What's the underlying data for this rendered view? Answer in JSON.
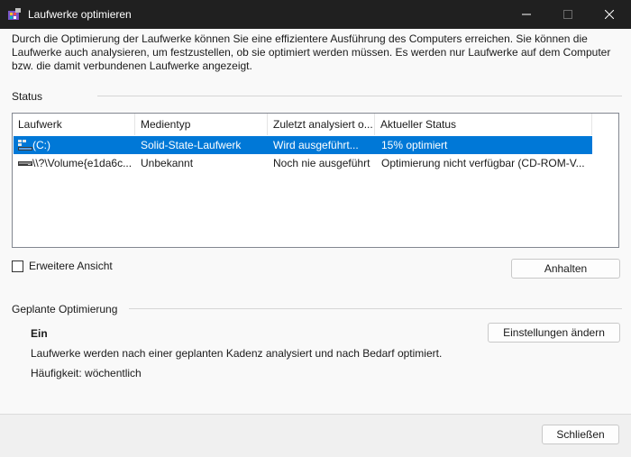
{
  "window": {
    "title": "Laufwerke optimieren"
  },
  "intro": {
    "text": "Durch die Optimierung der Laufwerke können Sie eine effizientere Ausführung des Computers erreichen. Sie können die Laufwerke auch analysieren, um festzustellen, ob sie optimiert werden müssen. Es werden nur Laufwerke auf dem Computer bzw. die damit verbundenen Laufwerke angezeigt."
  },
  "status": {
    "label": "Status",
    "columns": [
      "Laufwerk",
      "Medientyp",
      "Zuletzt analysiert o...",
      "Aktueller Status"
    ],
    "rows": [
      {
        "icon": "ssd-drive-icon",
        "drive": "(C:)",
        "media_type": "Solid-State-Laufwerk",
        "last_analyzed": "Wird ausgeführt...",
        "current_status": "15% optimiert",
        "selected": true
      },
      {
        "icon": "cdrom-drive-icon",
        "drive": "\\\\?\\Volume{e1da6c...",
        "media_type": "Unbekannt",
        "last_analyzed": "Noch nie ausgeführt",
        "current_status": "Optimierung nicht verfügbar (CD-ROM-V...",
        "selected": false
      }
    ],
    "advanced_view_label": "Erweitere Ansicht",
    "advanced_view_checked": false,
    "stop_button": "Anhalten"
  },
  "scheduled": {
    "label": "Geplante Optimierung",
    "state": "Ein",
    "change_settings_button": "Einstellungen ändern",
    "description": "Laufwerke werden nach einer geplanten Kadenz analysiert und nach Bedarf optimiert.",
    "frequency": "Häufigkeit: wöchentlich"
  },
  "footer": {
    "close_button": "Schließen"
  },
  "colors": {
    "selection": "#0078d7",
    "titlebar": "#202020"
  }
}
